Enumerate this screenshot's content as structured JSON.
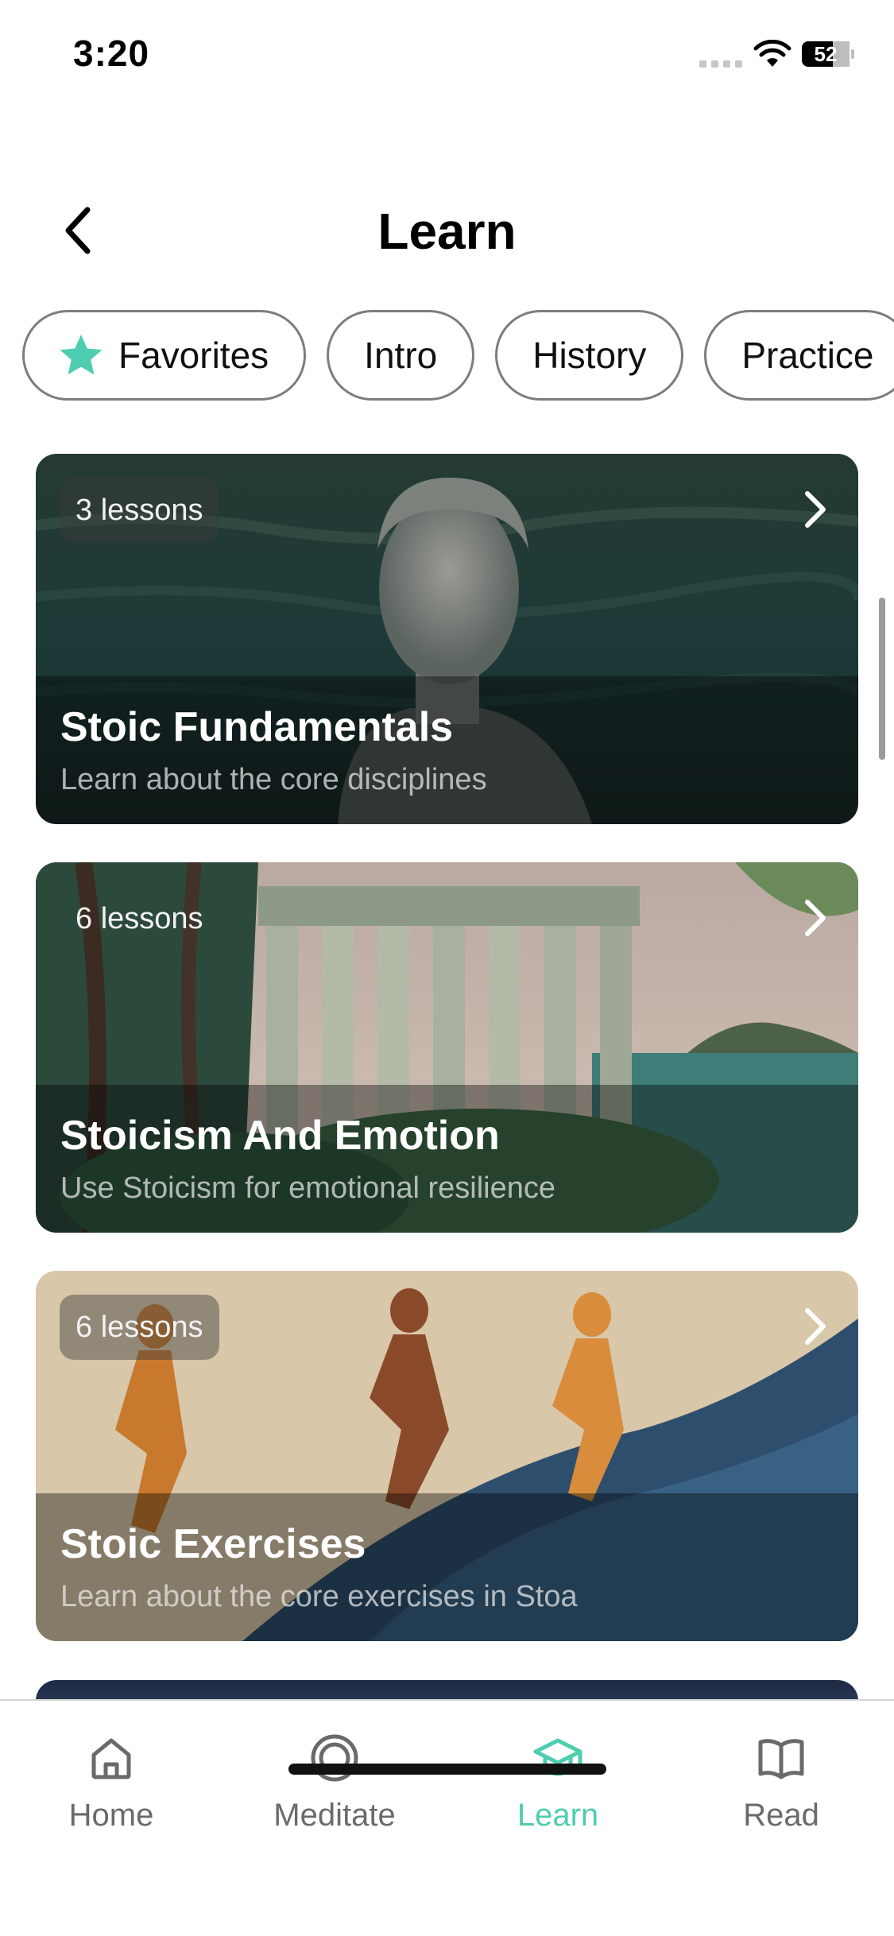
{
  "status_bar": {
    "time": "3:20",
    "battery": "52"
  },
  "header": {
    "title": "Learn",
    "back_icon": "chevron-left-icon"
  },
  "filters": [
    {
      "label": "Favorites",
      "icon": "star-icon",
      "icon_color": "#4ecdb0"
    },
    {
      "label": "Intro"
    },
    {
      "label": "History"
    },
    {
      "label": "Practice"
    }
  ],
  "courses": [
    {
      "lessons": "3 lessons",
      "title": "Stoic Fundamentals",
      "subtitle": "Learn about the core disciplines",
      "image": "statue-in-water"
    },
    {
      "lessons": "6 lessons",
      "title": "Stoicism And Emotion",
      "subtitle": "Use Stoicism for emotional resilience",
      "image": "greek-temple-by-sea"
    },
    {
      "lessons": "6 lessons",
      "title": "Stoic Exercises",
      "subtitle": "Learn about the core exercises in Stoa",
      "image": "running-figures-mosaic"
    }
  ],
  "tabs": [
    {
      "label": "Home",
      "icon": "house-icon",
      "active": false
    },
    {
      "label": "Meditate",
      "icon": "circle-target-icon",
      "active": false
    },
    {
      "label": "Learn",
      "icon": "graduation-cap-icon",
      "active": true
    },
    {
      "label": "Read",
      "icon": "open-book-icon",
      "active": false
    }
  ],
  "colors": {
    "accent": "#4ecdb0",
    "inactive": "#6a6a6a"
  }
}
